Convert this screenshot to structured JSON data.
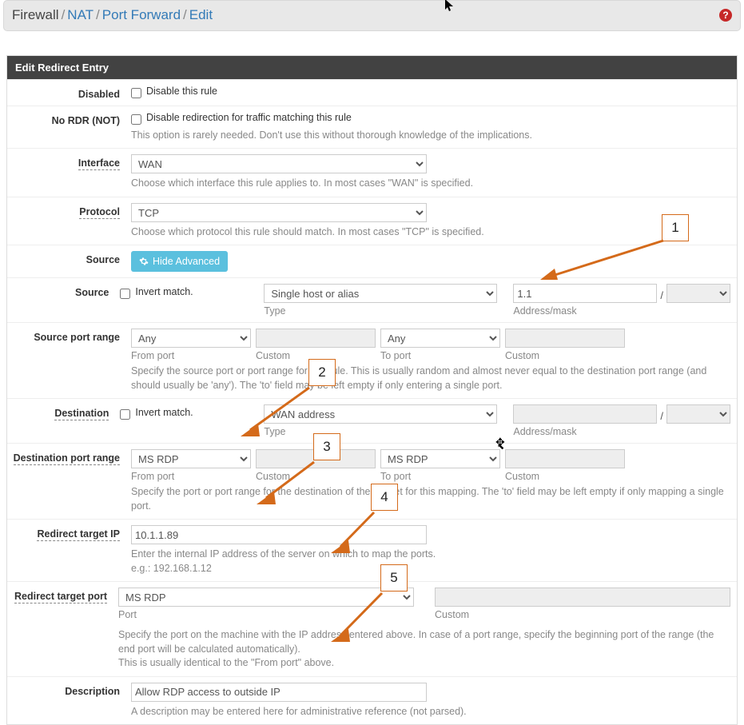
{
  "breadcrumb": {
    "p0": "Firewall",
    "p1": "NAT",
    "p2": "Port Forward",
    "p3": "Edit",
    "sep": "/"
  },
  "panel_title": "Edit Redirect Entry",
  "labels": {
    "disabled": "Disabled",
    "no_rdr": "No RDR (NOT)",
    "interface": "Interface",
    "protocol": "Protocol",
    "source_hdr": "Source",
    "source": "Source",
    "src_port_range": "Source port range",
    "destination": "Destination",
    "dst_port_range": "Destination port range",
    "redirect_ip": "Redirect target IP",
    "redirect_port": "Redirect target port",
    "description": "Description"
  },
  "checks": {
    "disable_rule": "Disable this rule",
    "disable_redirect": "Disable redirection for traffic matching this rule",
    "invert_match": "Invert match."
  },
  "help": {
    "no_rdr": "This option is rarely needed. Don't use this without thorough knowledge of the implications.",
    "interface": "Choose which interface this rule applies to. In most cases \"WAN\" is specified.",
    "protocol": "Choose which protocol this rule should match. In most cases \"TCP\" is specified.",
    "src_port": "Specify the source port or port range for this rule. This is usually random and almost never equal to the destination port range (and should usually be 'any'). The 'to' field may be left empty if only entering a single port.",
    "dst_port": "Specify the port or port range for the destination of the packet for this mapping. The 'to' field may be left empty if only mapping a single port.",
    "redirect_ip": "Enter the internal IP address of the server on which to map the ports.",
    "redirect_ip2": "e.g.: 192.168.1.12",
    "redirect_port": "Specify the port on the machine with the IP address entered above. In case of a port range, specify the beginning port of the range (the end port will be calculated automatically).",
    "redirect_port2": "This is usually identical to the \"From port\" above.",
    "description": "A description may be entered here for administrative reference (not parsed)."
  },
  "sublabels": {
    "type": "Type",
    "addr_mask": "Address/mask",
    "from_port": "From port",
    "to_port": "To port",
    "custom": "Custom",
    "port": "Port"
  },
  "values": {
    "interface": "WAN",
    "protocol": "TCP",
    "source_type": "Single host or alias",
    "source_addr": "1.1",
    "src_from": "Any",
    "src_to": "Any",
    "dest_type": "WAN address",
    "dst_from": "MS RDP",
    "dst_to": "MS RDP",
    "redirect_ip": "10.1.1.89",
    "redirect_port": "MS RDP",
    "description": "Allow RDP access to outside IP"
  },
  "buttons": {
    "hide_advanced": "Hide Advanced"
  },
  "callouts": {
    "c1": "1",
    "c2": "2",
    "c3": "3",
    "c4": "4",
    "c5": "5"
  },
  "slash": "/"
}
